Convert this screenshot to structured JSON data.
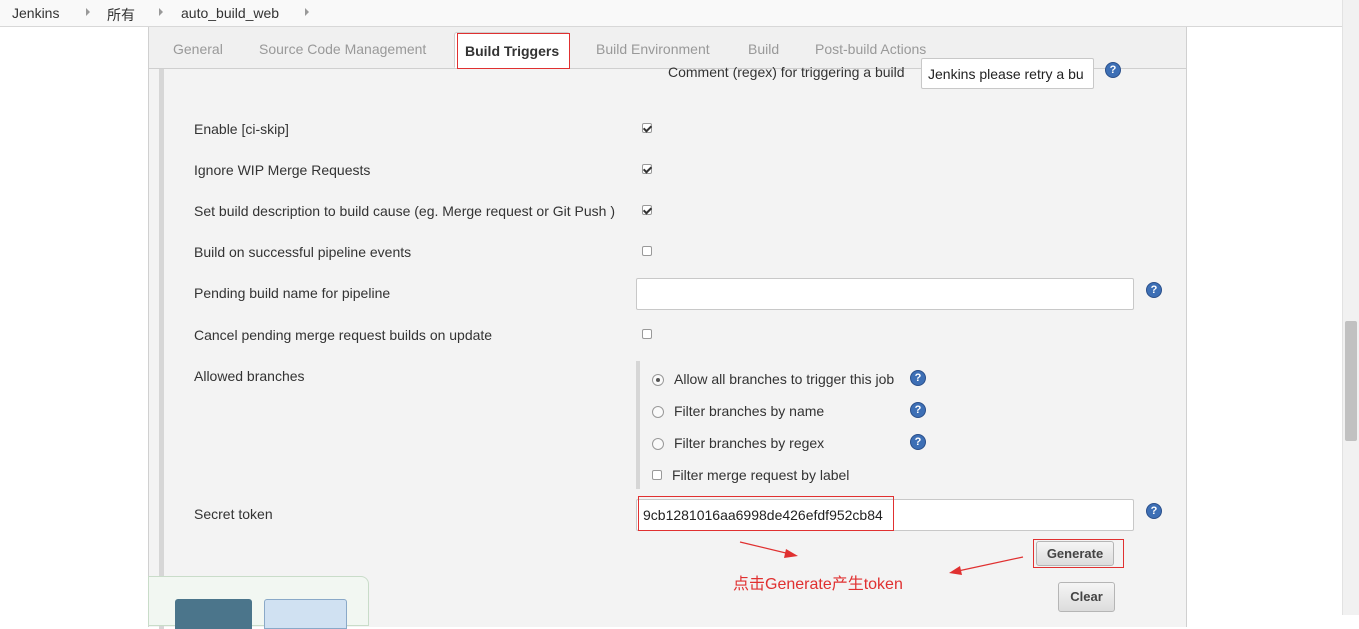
{
  "breadcrumb": [
    "Jenkins",
    "所有",
    "auto_build_web"
  ],
  "tabs": [
    "General",
    "Source Code Management",
    "Build Triggers",
    "Build Environment",
    "Build",
    "Post-build Actions"
  ],
  "active_tab": "Build Triggers",
  "comment_regex": {
    "label": "Comment (regex) for triggering a build",
    "value": "Jenkins please retry a bu"
  },
  "options": [
    {
      "label": "Enable [ci-skip]",
      "checked": true
    },
    {
      "label": "Ignore WIP Merge Requests",
      "checked": true
    },
    {
      "label": "Set build description to build cause (eg. Merge request or Git Push )",
      "checked": true
    },
    {
      "label": "Build on successful pipeline events",
      "checked": false
    }
  ],
  "pending_build_name": {
    "label": "Pending build name for pipeline",
    "value": ""
  },
  "cancel_pending": {
    "label": "Cancel pending merge request builds on update",
    "checked": false
  },
  "allowed_branches": {
    "label": "Allowed branches",
    "choices": [
      {
        "label": "Allow all branches to trigger this job",
        "selected": true
      },
      {
        "label": "Filter branches by name",
        "selected": false
      },
      {
        "label": "Filter branches by regex",
        "selected": false
      }
    ],
    "filter_label": "Filter merge request by label"
  },
  "secret_token": {
    "label": "Secret token",
    "value": "9cb1281016aa6998de426efdf952cb84"
  },
  "buttons": {
    "generate": "Generate",
    "clear": "Clear"
  },
  "annotation": "点击Generate产生token",
  "help_glyph": "?",
  "colors": {
    "accent_red": "#e03030",
    "help_blue": "#3d6fb5"
  }
}
